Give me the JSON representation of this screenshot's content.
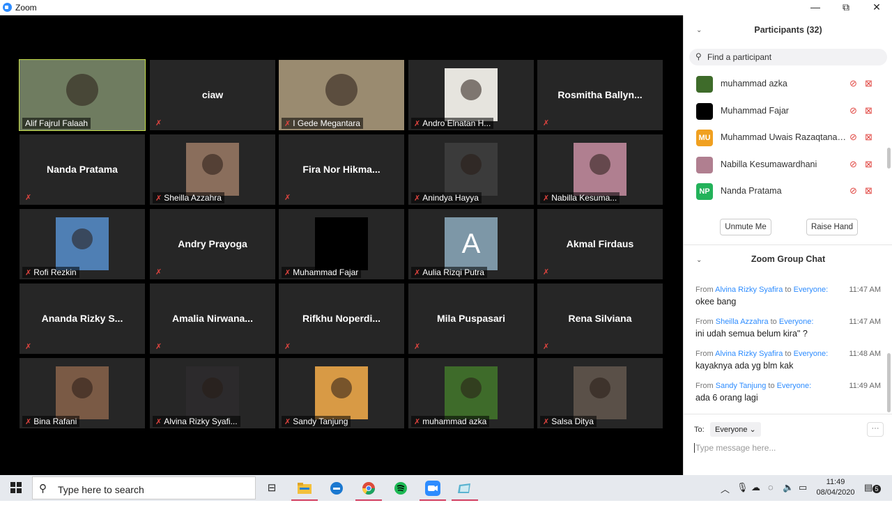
{
  "window": {
    "title": "Zoom",
    "minimize": "—",
    "restore": "⧉",
    "close": "✕"
  },
  "tiles": [
    {
      "name": "Alif Fajrul Falaah",
      "style": "photo-full",
      "bg": "#6f7c60",
      "active": true
    },
    {
      "name": "ciaw",
      "style": "text"
    },
    {
      "name": "I Gede Megantara",
      "style": "photo-full",
      "bg": "#9a8b70"
    },
    {
      "name": "Andro Elnatan H...",
      "style": "photo",
      "bg": "#e6e4de"
    },
    {
      "name": "Rosmitha Ballyn...",
      "style": "text"
    },
    {
      "name": "Nanda Pratama",
      "style": "text"
    },
    {
      "name": "Sheilla Azzahra",
      "style": "photo",
      "bg": "#8a6e5c"
    },
    {
      "name": "Fira Nor Hikma...",
      "style": "text"
    },
    {
      "name": "Anindya Hayya",
      "style": "photo",
      "bg": "#3b3b3b"
    },
    {
      "name": "Nabilla Kesuma...",
      "style": "photo",
      "bg": "#b07f90"
    },
    {
      "name": "Rofi Rezkin",
      "style": "photo",
      "bg": "#4f7fb4"
    },
    {
      "name": "Andry Prayoga",
      "style": "text"
    },
    {
      "name": "Muhammad Fajar",
      "style": "black"
    },
    {
      "name": "Aulia Rizqi Putra",
      "style": "letter",
      "letter": "A"
    },
    {
      "name": "Akmal Firdaus",
      "style": "text"
    },
    {
      "name": "Ananda Rizky S...",
      "style": "text"
    },
    {
      "name": "Amalia Nirwana...",
      "style": "text"
    },
    {
      "name": "Rifkhu Noperdi...",
      "style": "text"
    },
    {
      "name": "Mila Puspasari",
      "style": "text"
    },
    {
      "name": "Rena Silviana",
      "style": "text"
    },
    {
      "name": "Bina Rafani",
      "style": "photo",
      "bg": "#7a5a45"
    },
    {
      "name": "Alvina Rizky Syafi...",
      "style": "photo",
      "bg": "#2c2a2c"
    },
    {
      "name": "Sandy Tanjung",
      "style": "photo",
      "bg": "#d89a45"
    },
    {
      "name": "muhammad azka",
      "style": "photo",
      "bg": "#3e6b2a"
    },
    {
      "name": "Salsa Ditya",
      "style": "photo",
      "bg": "#5a5048"
    }
  ],
  "participants": {
    "header": "Participants (32)",
    "search_placeholder": "Find a participant",
    "list": [
      {
        "name": "muhammad azka",
        "initials": "",
        "color": "#3e6b2a"
      },
      {
        "name": "Muhammad Fajar",
        "initials": "",
        "color": "#000000"
      },
      {
        "name": "Muhammad Uwais Razaqtana_6...",
        "initials": "MU",
        "color": "#f0a020"
      },
      {
        "name": "Nabilla Kesumawardhani",
        "initials": "",
        "color": "#b07f90"
      },
      {
        "name": "Nanda Pratama",
        "initials": "NP",
        "color": "#23b25a"
      }
    ],
    "unmute_label": "Unmute Me",
    "raise_hand_label": "Raise Hand"
  },
  "chat": {
    "header": "Zoom Group Chat",
    "messages": [
      {
        "from_label": "From",
        "sender": "Alvina Rizky Syafira",
        "to_label": "to",
        "recipient": "Everyone:",
        "time": "11:47 AM",
        "text": "okee bang"
      },
      {
        "from_label": "From",
        "sender": "Sheilla Azzahra",
        "to_label": "to",
        "recipient": "Everyone:",
        "time": "11:47 AM",
        "text": "ini udah semua belum kira\" ?"
      },
      {
        "from_label": "From",
        "sender": "Alvina Rizky Syafira",
        "to_label": "to",
        "recipient": "Everyone:",
        "time": "11:48 AM",
        "text": "kayaknya ada yg blm kak"
      },
      {
        "from_label": "From",
        "sender": "Sandy Tanjung",
        "to_label": "to",
        "recipient": "Everyone:",
        "time": "11:49 AM",
        "text": "ada 6 orang lagi"
      }
    ],
    "to_label": "To:",
    "recipient_select": "Everyone ⌄",
    "more": "···",
    "input_placeholder": "Type message here..."
  },
  "taskbar": {
    "search_placeholder": "Type here to search",
    "time": "11:49",
    "date": "08/04/2020",
    "notifications": "5"
  }
}
